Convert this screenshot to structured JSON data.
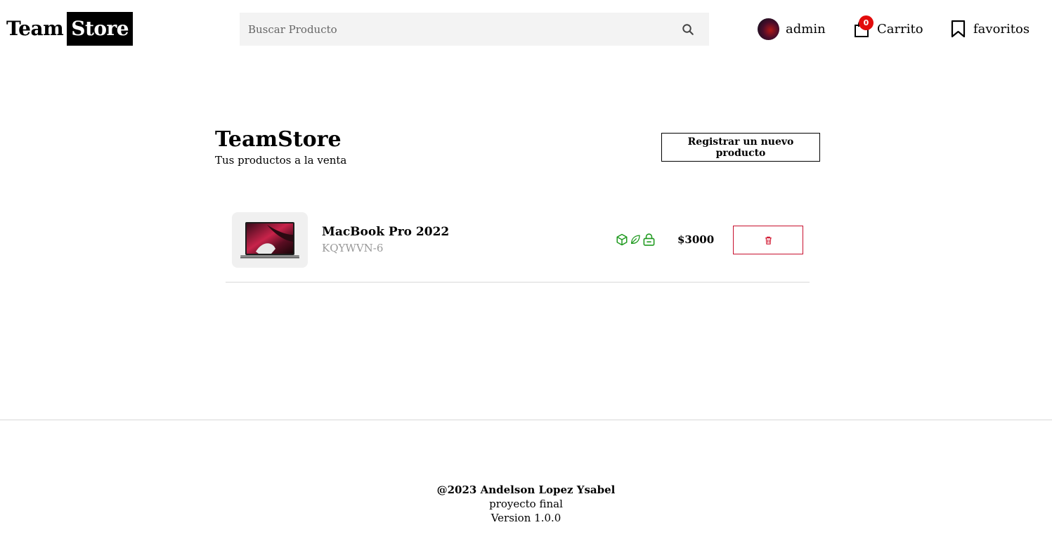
{
  "header": {
    "logo_team": "Team",
    "logo_store": "Store",
    "search_placeholder": "Buscar Producto",
    "user_label": "admin",
    "cart_label": "Carrito",
    "cart_count": "0",
    "favorites_label": "favoritos"
  },
  "main": {
    "title": "TeamStore",
    "subtitle": "Tus productos a la venta",
    "register_button": "Registrar un nuevo producto",
    "products": [
      {
        "name": "MacBook Pro 2022",
        "code": "KQYWVN-6",
        "price": "$3000",
        "badge_icons": [
          "box-icon",
          "leaf-icon",
          "lock-icon"
        ],
        "badge_color": "#1f9a1f"
      }
    ]
  },
  "footer": {
    "copyright": "@2023 Andelson Lopez Ysabel",
    "project": "proyecto final",
    "version": "Version 1.0.0"
  },
  "colors": {
    "accent_badge": "#e20b0b",
    "delete_red": "#c8102e",
    "search_bg": "#f3f3f3"
  }
}
